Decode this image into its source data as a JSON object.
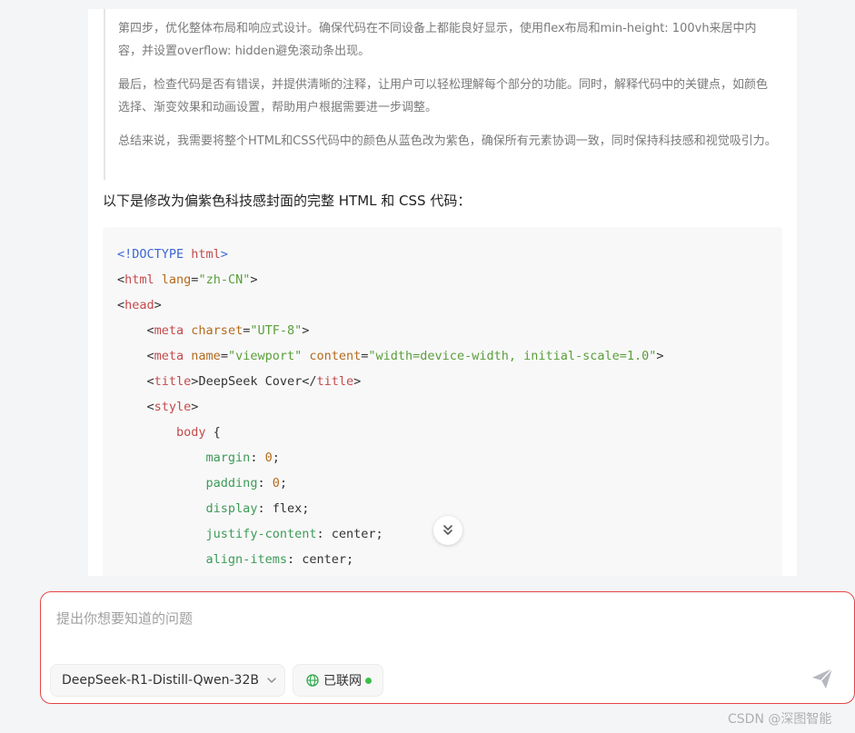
{
  "thinking": {
    "paragraphs": [
      "第四步，优化整体布局和响应式设计。确保代码在不同设备上都能良好显示，使用flex布局和min-height: 100vh来居中内容，并设置overflow: hidden避免滚动条出现。",
      "最后，检查代码是否有错误，并提供清晰的注释，让用户可以轻松理解每个部分的功能。同时，解释代码中的关键点，如颜色选择、渐变效果和动画设置，帮助用户根据需要进一步调整。",
      "总结来说，我需要将整个HTML和CSS代码中的颜色从蓝色改为紫色，确保所有元素协调一致，同时保持科技感和视觉吸引力。"
    ]
  },
  "answer": {
    "lead": "以下是修改为偏紫色科技感封面的完整 HTML 和 CSS 代码："
  },
  "code": {
    "l1a": "<!DOCTYPE",
    "l1b": " html",
    "l1c": ">",
    "l2_lt": "<",
    "l2_tag": "html",
    "l2_attr": " lang",
    "l2_eq": "=",
    "l2_str": "\"zh-CN\"",
    "l2_gt": ">",
    "l3_lt": "<",
    "l3_tag": "head",
    "l3_gt": ">",
    "l4_indent": "    ",
    "l4_lt": "<",
    "l4_tag": "meta",
    "l4_attr": " charset",
    "l4_eq": "=",
    "l4_str": "\"UTF-8\"",
    "l4_gt": ">",
    "l5_indent": "    ",
    "l5_lt": "<",
    "l5_tag": "meta",
    "l5_attr1": " name",
    "l5_eq1": "=",
    "l5_str1": "\"viewport\"",
    "l5_attr2": " content",
    "l5_eq2": "=",
    "l5_str2": "\"width=device-width, initial-scale=1.0\"",
    "l5_gt": ">",
    "l6_indent": "    ",
    "l6_lt": "<",
    "l6_tag": "title",
    "l6_gt": ">",
    "l6_text": "DeepSeek Cover",
    "l6_close_lt": "</",
    "l6_close_tag": "title",
    "l6_close_gt": ">",
    "l7_indent": "    ",
    "l7_lt": "<",
    "l7_tag": "style",
    "l7_gt": ">",
    "l8_indent": "        ",
    "l8_sel": "body",
    "l8_brace": " {",
    "l9_indent": "            ",
    "l9_prop": "margin",
    "l9_colon": ": ",
    "l9_val": "0",
    "l9_semi": ";",
    "l10_indent": "            ",
    "l10_prop": "padding",
    "l10_colon": ": ",
    "l10_val": "0",
    "l10_semi": ";",
    "l11_indent": "            ",
    "l11_prop": "display",
    "l11_colon": ": ",
    "l11_val": "flex;",
    "l12_indent": "            ",
    "l12_prop": "justify-content",
    "l12_colon": ": ",
    "l12_val": "center;",
    "l13_indent": "            ",
    "l13_prop": "align-items",
    "l13_colon": ": ",
    "l13_val": "center;"
  },
  "input": {
    "placeholder": "提出你想要知道的问题",
    "model": "DeepSeek-R1-Distill-Qwen-32B",
    "network_label": "已联网"
  },
  "watermark": "CSDN @深图智能",
  "icons": {
    "scroll": "double-chevron-down-icon",
    "model_chevron": "chevron-down-icon",
    "network": "globe-icon",
    "send": "paper-plane-icon"
  },
  "colors": {
    "input_border": "#e64545",
    "network_dot": "#3cbf4a",
    "send_icon": "#b5b8bf"
  }
}
